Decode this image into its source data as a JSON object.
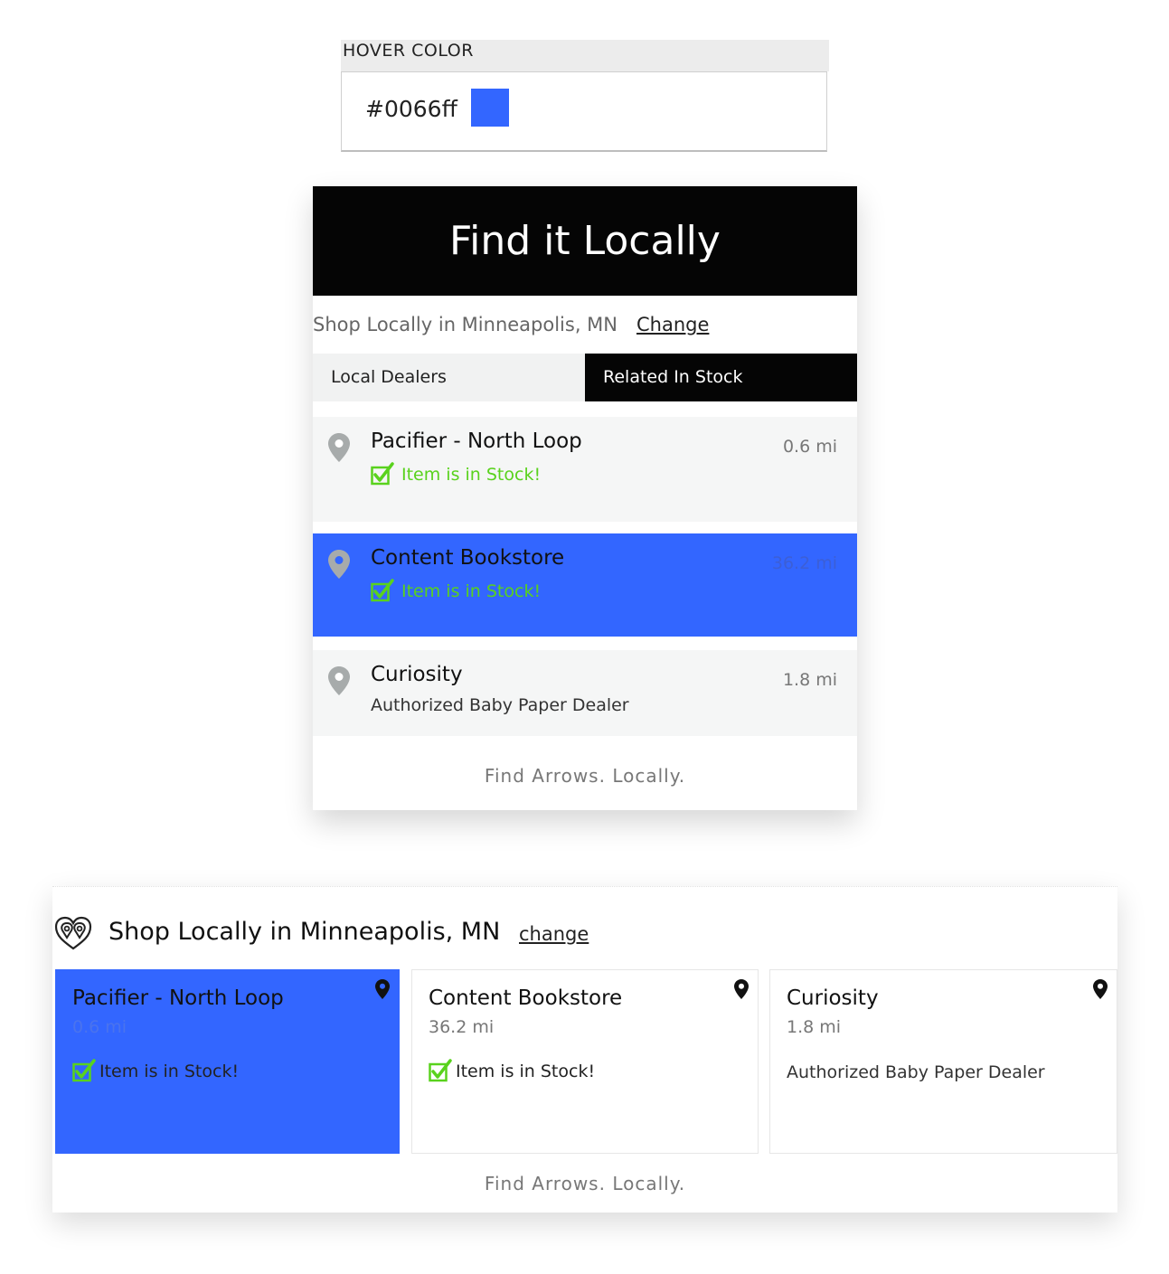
{
  "hover_setting": {
    "label": "HOVER COLOR",
    "value": "#0066ff",
    "swatch_color": "#3366ff"
  },
  "colors": {
    "hover": "#3366ff",
    "header_bg": "#050505",
    "stock_green": "#59d21d",
    "row_bg": "#f5f6f6"
  },
  "widget": {
    "title": "Find it Locally",
    "location_text": "Shop Locally in Minneapolis, MN",
    "change_label": "Change",
    "tabs": [
      {
        "label": "Local Dealers",
        "active": false
      },
      {
        "label": "Related In Stock",
        "active": true
      }
    ],
    "dealers": [
      {
        "name": "Pacifier - North Loop",
        "distance": "0.6 mi",
        "status": "Item is in Stock!",
        "hovered": false
      },
      {
        "name": "Content Bookstore",
        "distance": "36.2 mi",
        "status": "Item is in Stock!",
        "hovered": true
      },
      {
        "name": "Curiosity",
        "distance": "1.8 mi",
        "status": "Authorized Baby Paper Dealer",
        "hovered": false
      }
    ],
    "footer": "Find Arrows. Locally."
  },
  "horizontal_widget": {
    "logo_icon": "heart-pin-logo-icon",
    "title": "Shop Locally in Minneapolis, MN",
    "change_label": "change",
    "cards": [
      {
        "name": "Pacifier - North Loop",
        "distance": "0.6 mi",
        "status": "Item is in Stock!",
        "hovered": true
      },
      {
        "name": "Content Bookstore",
        "distance": "36.2 mi",
        "status": "Item is in Stock!",
        "hovered": false
      },
      {
        "name": "Curiosity",
        "distance": "1.8 mi",
        "status": "Authorized Baby Paper Dealer",
        "hovered": false
      }
    ],
    "footer": "Find Arrows. Locally."
  }
}
